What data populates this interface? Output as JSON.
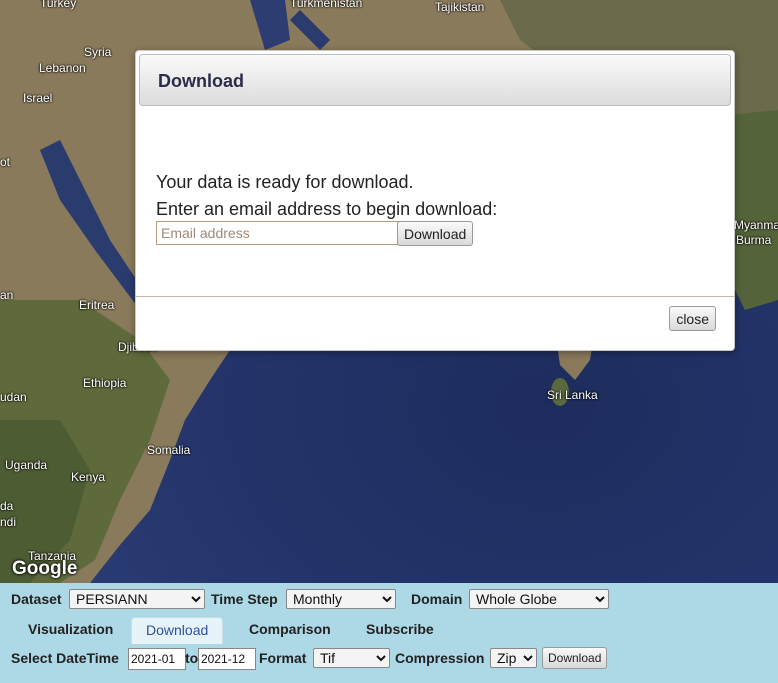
{
  "map": {
    "labels": {
      "turkey": "Turkey",
      "turkmenistan": "Turkmenistan",
      "tajikistan": "Tajikistan",
      "syria": "Syria",
      "lebanon": "Lebanon",
      "israel": "Israel",
      "eritrea": "Eritrea",
      "djibouti": "Djibouti",
      "ethiopia": "Ethiopia",
      "sudan": "udan",
      "somalia": "Somalia",
      "uganda": "Uganda",
      "kenya": "Kenya",
      "tanzania": "Tanzania",
      "sri_lanka": "Sri Lanka",
      "myanmar": "Myanma",
      "burma": "Burma",
      "egypt_fragment": "ot",
      "sudan_fragment": "an",
      "rwanda_fragment": "da",
      "burundi_fragment": "ndi"
    },
    "attribution": "Google"
  },
  "modal": {
    "title": "Download",
    "line1": "Your data is ready for download.",
    "line2": "Enter an email address to begin download:",
    "email_placeholder": "Email address",
    "download_label": "Download",
    "close_label": "close"
  },
  "panel": {
    "dataset_label": "Dataset",
    "dataset_value": "PERSIANN",
    "timestep_label": "Time Step",
    "timestep_value": "Monthly",
    "domain_label": "Domain",
    "domain_value": "Whole Globe",
    "tabs": [
      "Visualization",
      "Download",
      "Comparison",
      "Subscribe"
    ],
    "active_tab": "Download",
    "select_datetime_label": "Select DateTime",
    "date_from": "2021-01",
    "to_label": "to",
    "date_to": "2021-12",
    "format_label": "Format",
    "format_value": "Tif",
    "compression_label": "Compression",
    "compression_value": "Zip",
    "download_label": "Download"
  }
}
